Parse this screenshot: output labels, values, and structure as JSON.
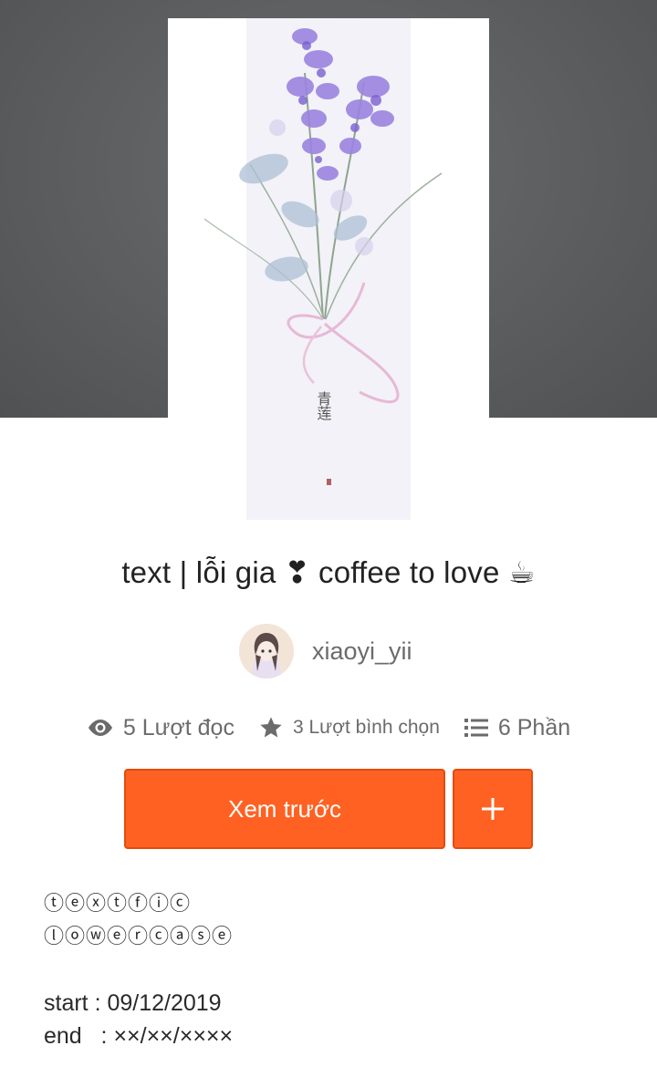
{
  "cover": {
    "seal_text": "青莲"
  },
  "story": {
    "title": "text | lỗi gia ❣ coffee to love ☕"
  },
  "author": {
    "name": "xiaoyi_yii"
  },
  "stats": {
    "reads": "5 Lượt đọc",
    "votes": "3 Lượt bình chọn",
    "parts": "6 Phần"
  },
  "actions": {
    "preview_label": "Xem trước",
    "add_label": "+"
  },
  "description": {
    "line1": "ⓣⓔⓧⓣⓕⓘⓒ",
    "line2": "ⓛⓞⓦⓔⓡⓒⓐⓢⓔ",
    "start": "start : 09/12/2019",
    "end": "end   : ××/××/××××"
  },
  "colors": {
    "accent": "#ff6122",
    "hero_background": "#5a5c5e",
    "muted_text": "#6b6b6b"
  },
  "icons": {
    "reads": "eye-icon",
    "votes": "star-icon",
    "parts": "list-icon",
    "add": "plus-icon"
  }
}
